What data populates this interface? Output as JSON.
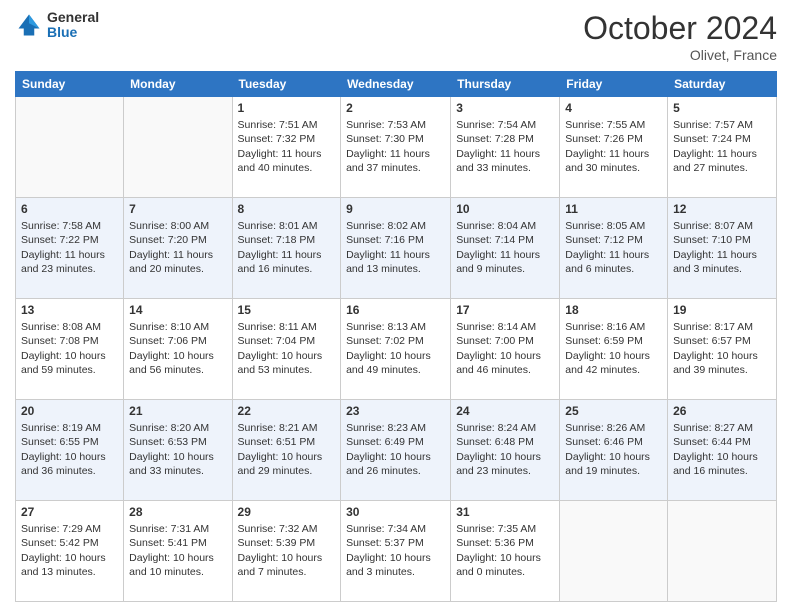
{
  "header": {
    "logo_line1": "General",
    "logo_line2": "Blue",
    "month_title": "October 2024",
    "location": "Olivet, France"
  },
  "days_of_week": [
    "Sunday",
    "Monday",
    "Tuesday",
    "Wednesday",
    "Thursday",
    "Friday",
    "Saturday"
  ],
  "weeks": [
    [
      {
        "day": "",
        "info": ""
      },
      {
        "day": "",
        "info": ""
      },
      {
        "day": "1",
        "info": "Sunrise: 7:51 AM\nSunset: 7:32 PM\nDaylight: 11 hours and 40 minutes."
      },
      {
        "day": "2",
        "info": "Sunrise: 7:53 AM\nSunset: 7:30 PM\nDaylight: 11 hours and 37 minutes."
      },
      {
        "day": "3",
        "info": "Sunrise: 7:54 AM\nSunset: 7:28 PM\nDaylight: 11 hours and 33 minutes."
      },
      {
        "day": "4",
        "info": "Sunrise: 7:55 AM\nSunset: 7:26 PM\nDaylight: 11 hours and 30 minutes."
      },
      {
        "day": "5",
        "info": "Sunrise: 7:57 AM\nSunset: 7:24 PM\nDaylight: 11 hours and 27 minutes."
      }
    ],
    [
      {
        "day": "6",
        "info": "Sunrise: 7:58 AM\nSunset: 7:22 PM\nDaylight: 11 hours and 23 minutes."
      },
      {
        "day": "7",
        "info": "Sunrise: 8:00 AM\nSunset: 7:20 PM\nDaylight: 11 hours and 20 minutes."
      },
      {
        "day": "8",
        "info": "Sunrise: 8:01 AM\nSunset: 7:18 PM\nDaylight: 11 hours and 16 minutes."
      },
      {
        "day": "9",
        "info": "Sunrise: 8:02 AM\nSunset: 7:16 PM\nDaylight: 11 hours and 13 minutes."
      },
      {
        "day": "10",
        "info": "Sunrise: 8:04 AM\nSunset: 7:14 PM\nDaylight: 11 hours and 9 minutes."
      },
      {
        "day": "11",
        "info": "Sunrise: 8:05 AM\nSunset: 7:12 PM\nDaylight: 11 hours and 6 minutes."
      },
      {
        "day": "12",
        "info": "Sunrise: 8:07 AM\nSunset: 7:10 PM\nDaylight: 11 hours and 3 minutes."
      }
    ],
    [
      {
        "day": "13",
        "info": "Sunrise: 8:08 AM\nSunset: 7:08 PM\nDaylight: 10 hours and 59 minutes."
      },
      {
        "day": "14",
        "info": "Sunrise: 8:10 AM\nSunset: 7:06 PM\nDaylight: 10 hours and 56 minutes."
      },
      {
        "day": "15",
        "info": "Sunrise: 8:11 AM\nSunset: 7:04 PM\nDaylight: 10 hours and 53 minutes."
      },
      {
        "day": "16",
        "info": "Sunrise: 8:13 AM\nSunset: 7:02 PM\nDaylight: 10 hours and 49 minutes."
      },
      {
        "day": "17",
        "info": "Sunrise: 8:14 AM\nSunset: 7:00 PM\nDaylight: 10 hours and 46 minutes."
      },
      {
        "day": "18",
        "info": "Sunrise: 8:16 AM\nSunset: 6:59 PM\nDaylight: 10 hours and 42 minutes."
      },
      {
        "day": "19",
        "info": "Sunrise: 8:17 AM\nSunset: 6:57 PM\nDaylight: 10 hours and 39 minutes."
      }
    ],
    [
      {
        "day": "20",
        "info": "Sunrise: 8:19 AM\nSunset: 6:55 PM\nDaylight: 10 hours and 36 minutes."
      },
      {
        "day": "21",
        "info": "Sunrise: 8:20 AM\nSunset: 6:53 PM\nDaylight: 10 hours and 33 minutes."
      },
      {
        "day": "22",
        "info": "Sunrise: 8:21 AM\nSunset: 6:51 PM\nDaylight: 10 hours and 29 minutes."
      },
      {
        "day": "23",
        "info": "Sunrise: 8:23 AM\nSunset: 6:49 PM\nDaylight: 10 hours and 26 minutes."
      },
      {
        "day": "24",
        "info": "Sunrise: 8:24 AM\nSunset: 6:48 PM\nDaylight: 10 hours and 23 minutes."
      },
      {
        "day": "25",
        "info": "Sunrise: 8:26 AM\nSunset: 6:46 PM\nDaylight: 10 hours and 19 minutes."
      },
      {
        "day": "26",
        "info": "Sunrise: 8:27 AM\nSunset: 6:44 PM\nDaylight: 10 hours and 16 minutes."
      }
    ],
    [
      {
        "day": "27",
        "info": "Sunrise: 7:29 AM\nSunset: 5:42 PM\nDaylight: 10 hours and 13 minutes."
      },
      {
        "day": "28",
        "info": "Sunrise: 7:31 AM\nSunset: 5:41 PM\nDaylight: 10 hours and 10 minutes."
      },
      {
        "day": "29",
        "info": "Sunrise: 7:32 AM\nSunset: 5:39 PM\nDaylight: 10 hours and 7 minutes."
      },
      {
        "day": "30",
        "info": "Sunrise: 7:34 AM\nSunset: 5:37 PM\nDaylight: 10 hours and 3 minutes."
      },
      {
        "day": "31",
        "info": "Sunrise: 7:35 AM\nSunset: 5:36 PM\nDaylight: 10 hours and 0 minutes."
      },
      {
        "day": "",
        "info": ""
      },
      {
        "day": "",
        "info": ""
      }
    ]
  ]
}
